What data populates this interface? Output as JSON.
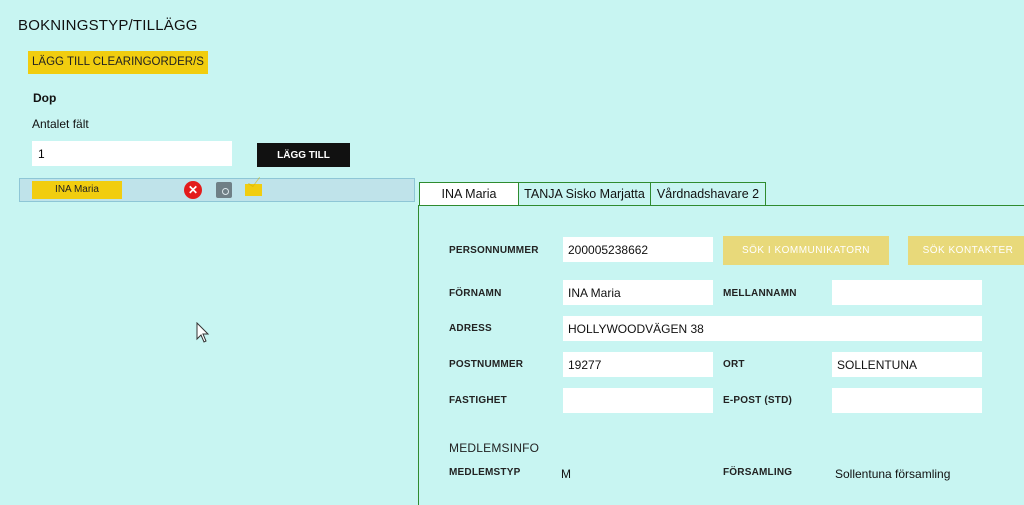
{
  "page": {
    "title": "BOKNINGSTYP/TILLÄGG",
    "clearing_button": "LÄGG TILL CLEARINGORDER/S",
    "booking_type": "Dop",
    "count_label": "Antalet fält",
    "count_value": "1",
    "add_button": "LÄGG TILL"
  },
  "person_list": [
    {
      "name": "INA Maria"
    }
  ],
  "tabs": [
    {
      "label": "INA Maria",
      "active": true
    },
    {
      "label": "TANJA Sisko Marjatta",
      "active": false
    },
    {
      "label": "Vårdnadshavare 2",
      "active": false
    }
  ],
  "form": {
    "personnummer_label": "PERSONNUMMER",
    "personnummer": "200005238662",
    "search_communicator": "SÖK I KOMMUNIKATORN",
    "search_contacts": "SÖK KONTAKTER",
    "fornamn_label": "FÖRNAMN",
    "fornamn": "INA Maria",
    "mellannamn_label": "MELLANNAMN",
    "mellannamn": "",
    "adress_label": "ADRESS",
    "adress": "HOLLYWOODVÄGEN 38",
    "postnummer_label": "POSTNUMMER",
    "postnummer": "19277",
    "ort_label": "ORT",
    "ort": "SOLLENTUNA",
    "fastighet_label": "FASTIGHET",
    "fastighet": "",
    "epost_label": "E-POST (STD)",
    "epost": ""
  },
  "member": {
    "section_title": "MEDLEMSINFO",
    "medlemstyp_label": "MEDLEMSTYP",
    "medlemstyp": "M",
    "forsamling_label": "FÖRSAMLING",
    "forsamling": "Sollentuna församling"
  },
  "icons": {
    "remove": "close-circle-icon",
    "search": "search-document-icon",
    "mail": "envelope-icon"
  },
  "colors": {
    "background": "#c8f5f2",
    "accent_yellow": "#f1cd0f",
    "tab_border": "#2f8b2f",
    "remove_red": "#e31b1b"
  }
}
